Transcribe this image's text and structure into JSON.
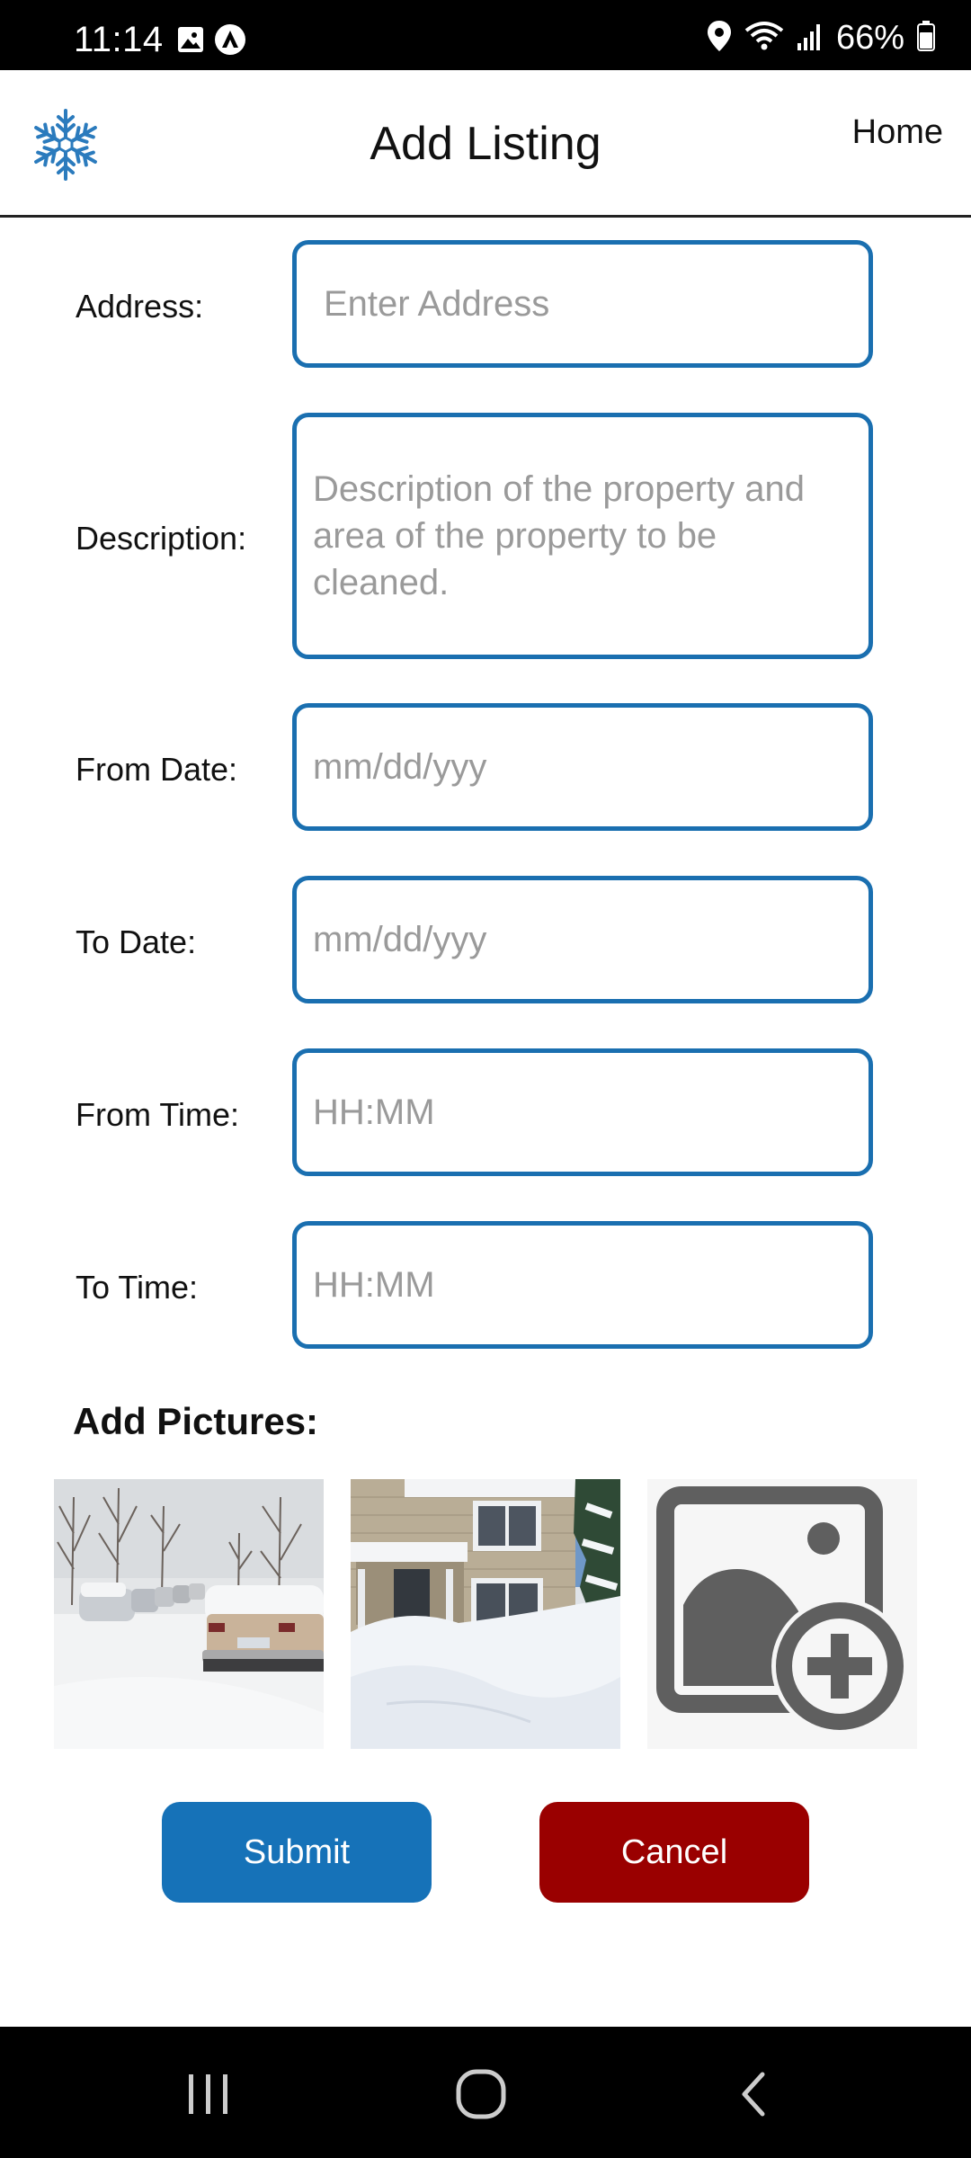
{
  "status_bar": {
    "time": "11:14",
    "battery": "66%",
    "icons": [
      "gallery-icon",
      "assistant-icon",
      "location-icon",
      "wifi-icon",
      "signal-icon",
      "battery-icon"
    ]
  },
  "header": {
    "logo_icon": "snowflake-icon",
    "title": "Add Listing",
    "home_link": "Home"
  },
  "form": {
    "address": {
      "label": "Address:",
      "placeholder": "Enter Address",
      "value": ""
    },
    "description": {
      "label": "Description:",
      "placeholder": "Description of the property and area of the property to be cleaned.",
      "value": ""
    },
    "from_date": {
      "label": "From Date:",
      "placeholder": "mm/dd/yyy",
      "value": ""
    },
    "to_date": {
      "label": "To Date:",
      "placeholder": "mm/dd/yyy",
      "value": ""
    },
    "from_time": {
      "label": "From Time:",
      "placeholder": "HH:MM",
      "value": ""
    },
    "to_time": {
      "label": "To Time:",
      "placeholder": "HH:MM",
      "value": ""
    }
  },
  "pictures": {
    "heading": "Add Pictures:",
    "items": [
      "snowy-street-photo",
      "snowy-house-photo",
      "add-image-icon"
    ]
  },
  "actions": {
    "submit": "Submit",
    "cancel": "Cancel"
  },
  "colors": {
    "accent": "#1a6fb0",
    "submit": "#1672b8",
    "cancel": "#9a0000"
  },
  "nav_bar": {
    "icons": [
      "recents-icon",
      "home-circle-icon",
      "back-icon"
    ]
  }
}
